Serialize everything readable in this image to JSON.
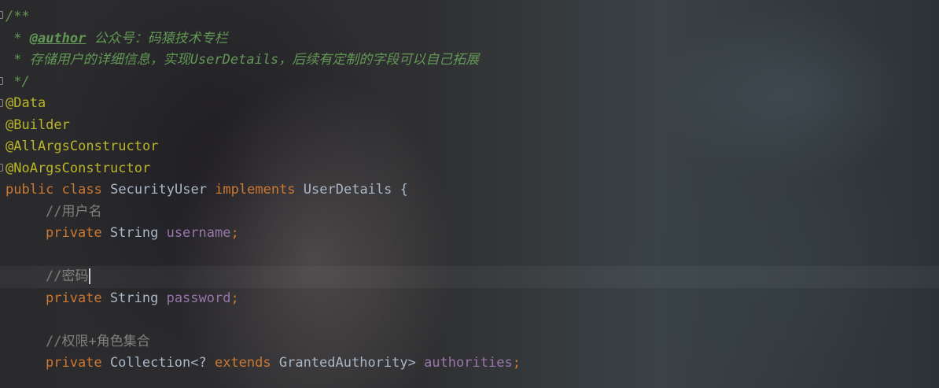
{
  "editor": {
    "language": "java",
    "theme_colors": {
      "background": "#2b2b2b",
      "javadoc": "#629755",
      "annotation": "#bbb529",
      "keyword": "#cc7832",
      "field": "#9876aa",
      "comment": "#808080",
      "text": "#a9b7c6"
    },
    "lines": {
      "doc_open": "/**",
      "doc_author_prefix": " * ",
      "doc_author_tag": "@author",
      "doc_author_text": " 公众号：码猿技术专栏",
      "doc_desc": " * 存储用户的详细信息，实现UserDetails，后续有定制的字段可以自己拓展",
      "doc_close": " */",
      "anno_data": "@Data",
      "anno_builder": "@Builder",
      "anno_all_args": "@AllArgsConstructor",
      "anno_no_args": "@NoArgsConstructor",
      "class_decl": {
        "kw_public": "public",
        "kw_class": "class",
        "class_name": "SecurityUser",
        "kw_implements": "implements",
        "interface_name": "UserDetails",
        "brace": "{"
      },
      "comment_username": "//用户名",
      "field_username": {
        "modifier": "private",
        "type": "String",
        "name": "username",
        "semi": ";"
      },
      "comment_password": "//密码",
      "field_password": {
        "modifier": "private",
        "type": "String",
        "name": "password",
        "semi": ";"
      },
      "comment_authorities": "//权限+角色集合",
      "field_authorities": {
        "modifier": "private",
        "type_prefix": "Collection<? ",
        "kw_extends": "extends",
        "type_suffix": " GrantedAuthority> ",
        "name": "authorities",
        "semi": ";"
      }
    }
  }
}
